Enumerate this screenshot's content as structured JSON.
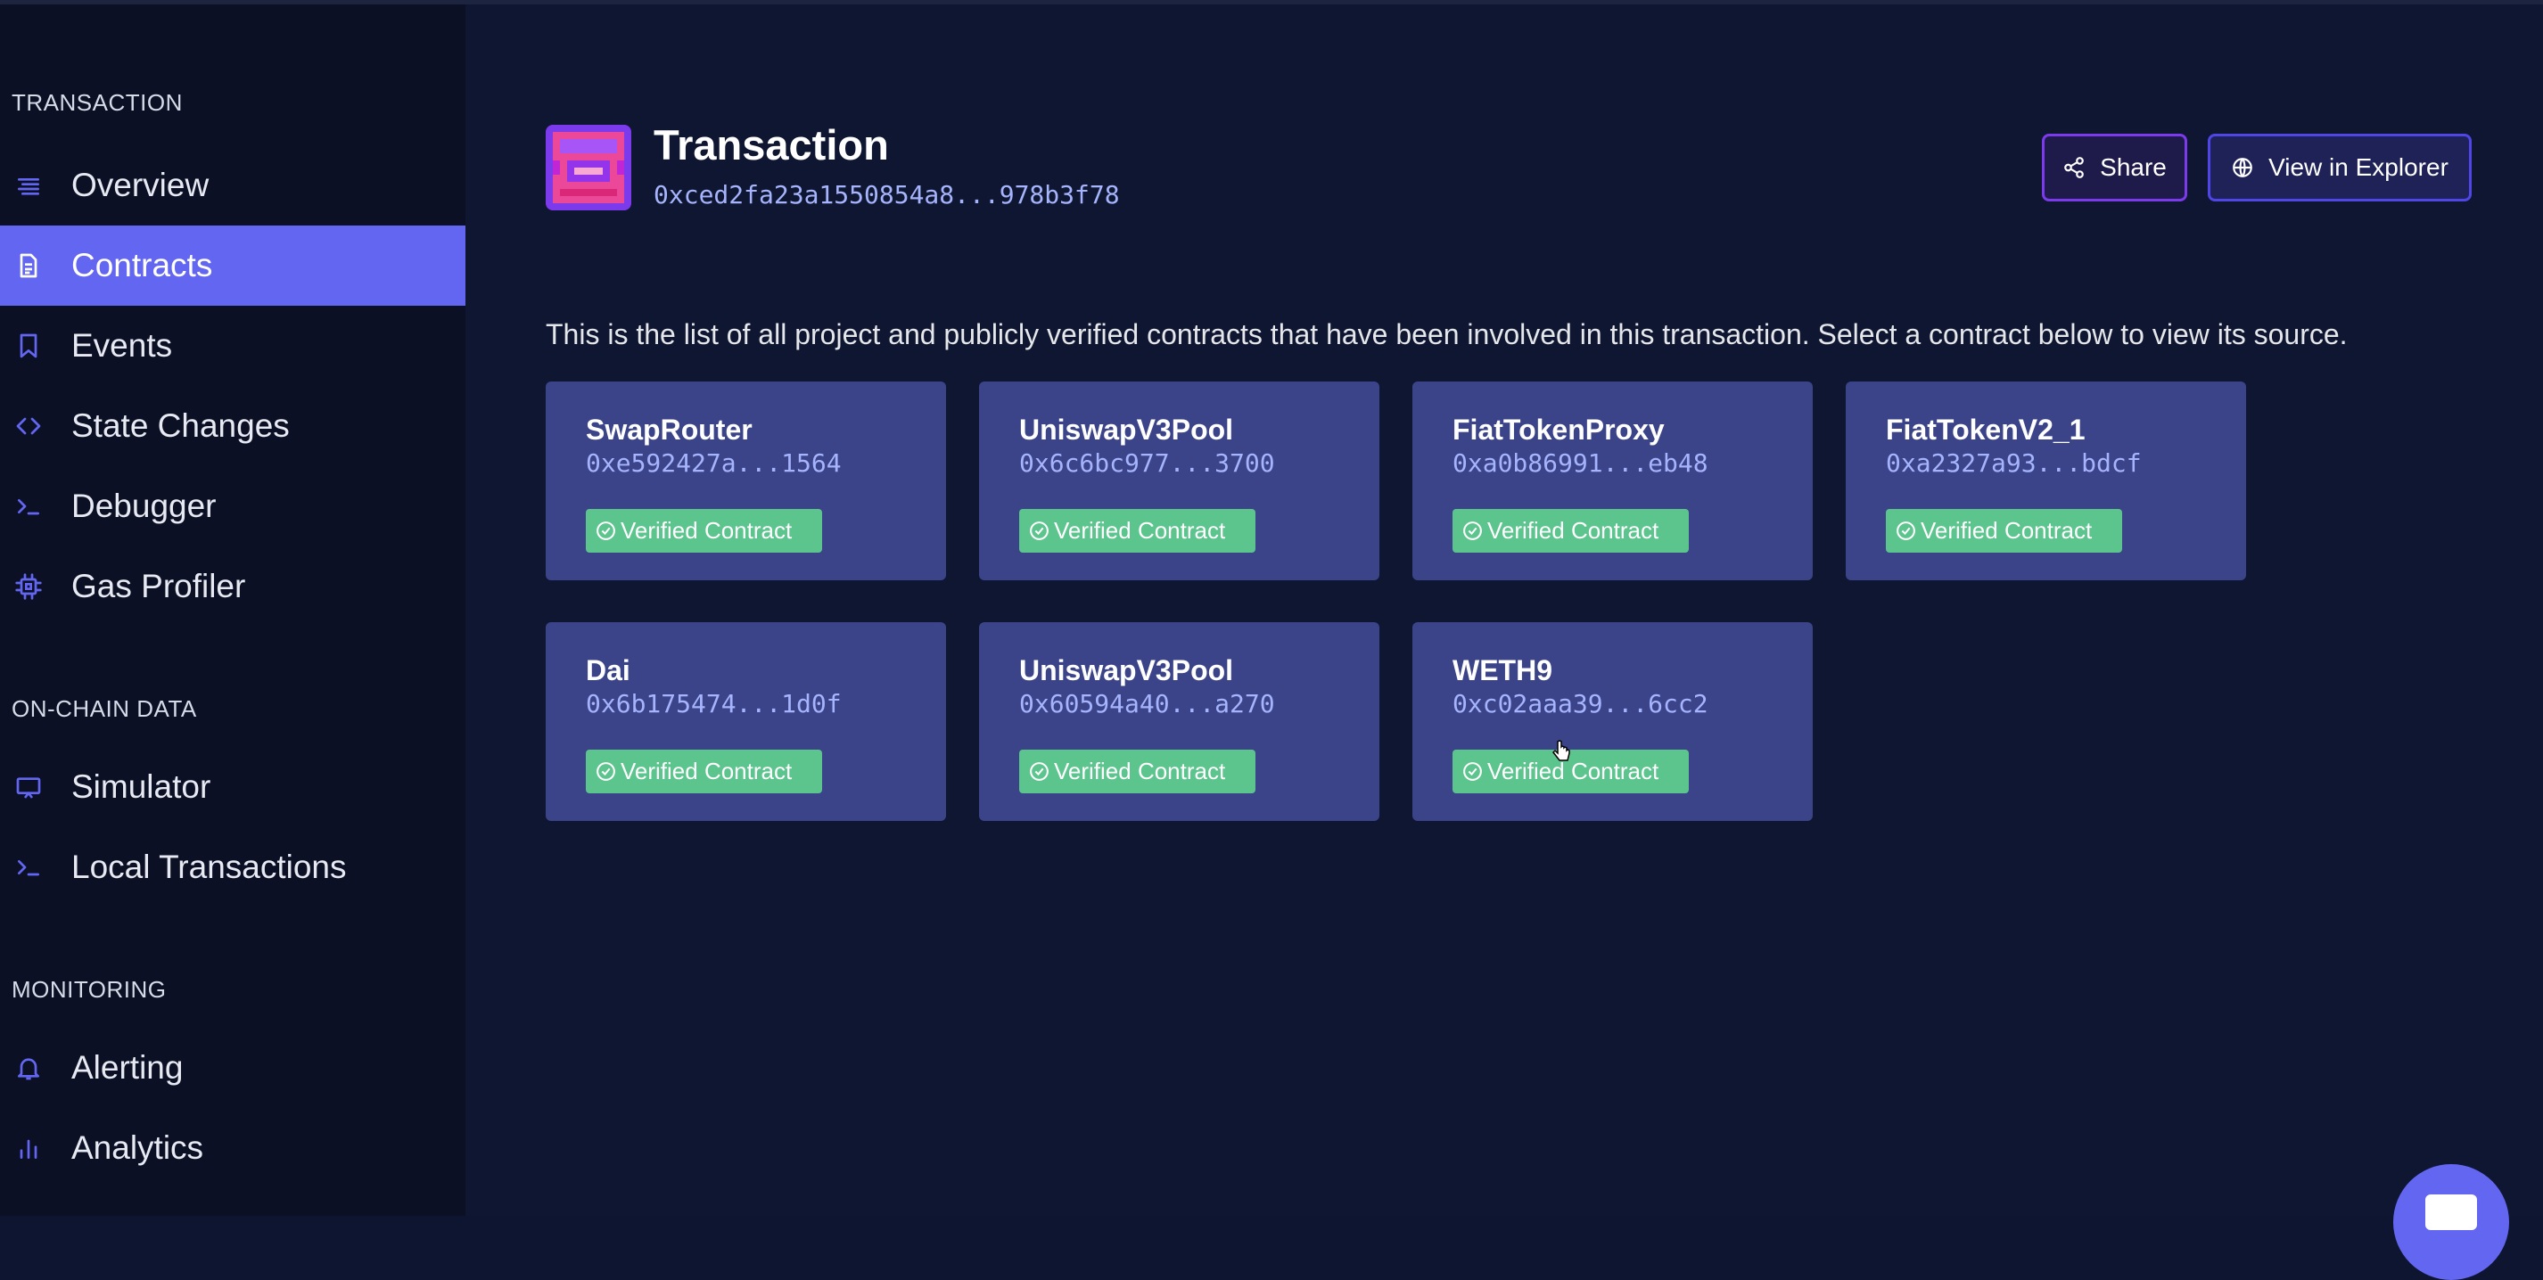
{
  "sidebar": {
    "sections": [
      {
        "title": "TRANSACTION"
      },
      {
        "title": "ON-CHAIN DATA"
      },
      {
        "title": "MONITORING"
      }
    ],
    "items": [
      {
        "label": "Overview",
        "icon": "list-icon",
        "active": false
      },
      {
        "label": "Contracts",
        "icon": "document-icon",
        "active": true
      },
      {
        "label": "Events",
        "icon": "bookmark-icon",
        "active": false
      },
      {
        "label": "State Changes",
        "icon": "code-icon",
        "active": false
      },
      {
        "label": "Debugger",
        "icon": "terminal-icon",
        "active": false
      },
      {
        "label": "Gas Profiler",
        "icon": "chip-icon",
        "active": false
      },
      {
        "label": "Simulator",
        "icon": "monitor-icon",
        "active": false
      },
      {
        "label": "Local Transactions",
        "icon": "terminal-icon",
        "active": false
      },
      {
        "label": "Alerting",
        "icon": "bell-icon",
        "active": false
      },
      {
        "label": "Analytics",
        "icon": "bar-chart-icon",
        "active": false
      }
    ]
  },
  "header": {
    "title": "Transaction",
    "hash": "0xced2fa23a1550854a8...978b3f78",
    "share_label": "Share",
    "explorer_label": "View in Explorer"
  },
  "description": "This is the list of all project and publicly verified contracts that have been involved in this transaction. Select a contract below to view its source.",
  "contracts": [
    {
      "name": "SwapRouter",
      "address": "0xe592427a...1564",
      "badge": "Verified Contract"
    },
    {
      "name": "UniswapV3Pool",
      "address": "0x6c6bc977...3700",
      "badge": "Verified Contract"
    },
    {
      "name": "FiatTokenProxy",
      "address": "0xa0b86991...eb48",
      "badge": "Verified Contract"
    },
    {
      "name": "FiatTokenV2_1",
      "address": "0xa2327a93...bdcf",
      "badge": "Verified Contract"
    },
    {
      "name": "Dai",
      "address": "0x6b175474...1d0f",
      "badge": "Verified Contract"
    },
    {
      "name": "UniswapV3Pool",
      "address": "0x60594a40...a270",
      "badge": "Verified Contract"
    },
    {
      "name": "WETH9",
      "address": "0xc02aaa39...6cc2",
      "badge": "Verified Contract"
    }
  ],
  "colors": {
    "accent": "#6366f1",
    "card": "#3b4489",
    "verified": "#5cc48d",
    "background": "#0f1631",
    "sidebar": "#0b1025"
  }
}
